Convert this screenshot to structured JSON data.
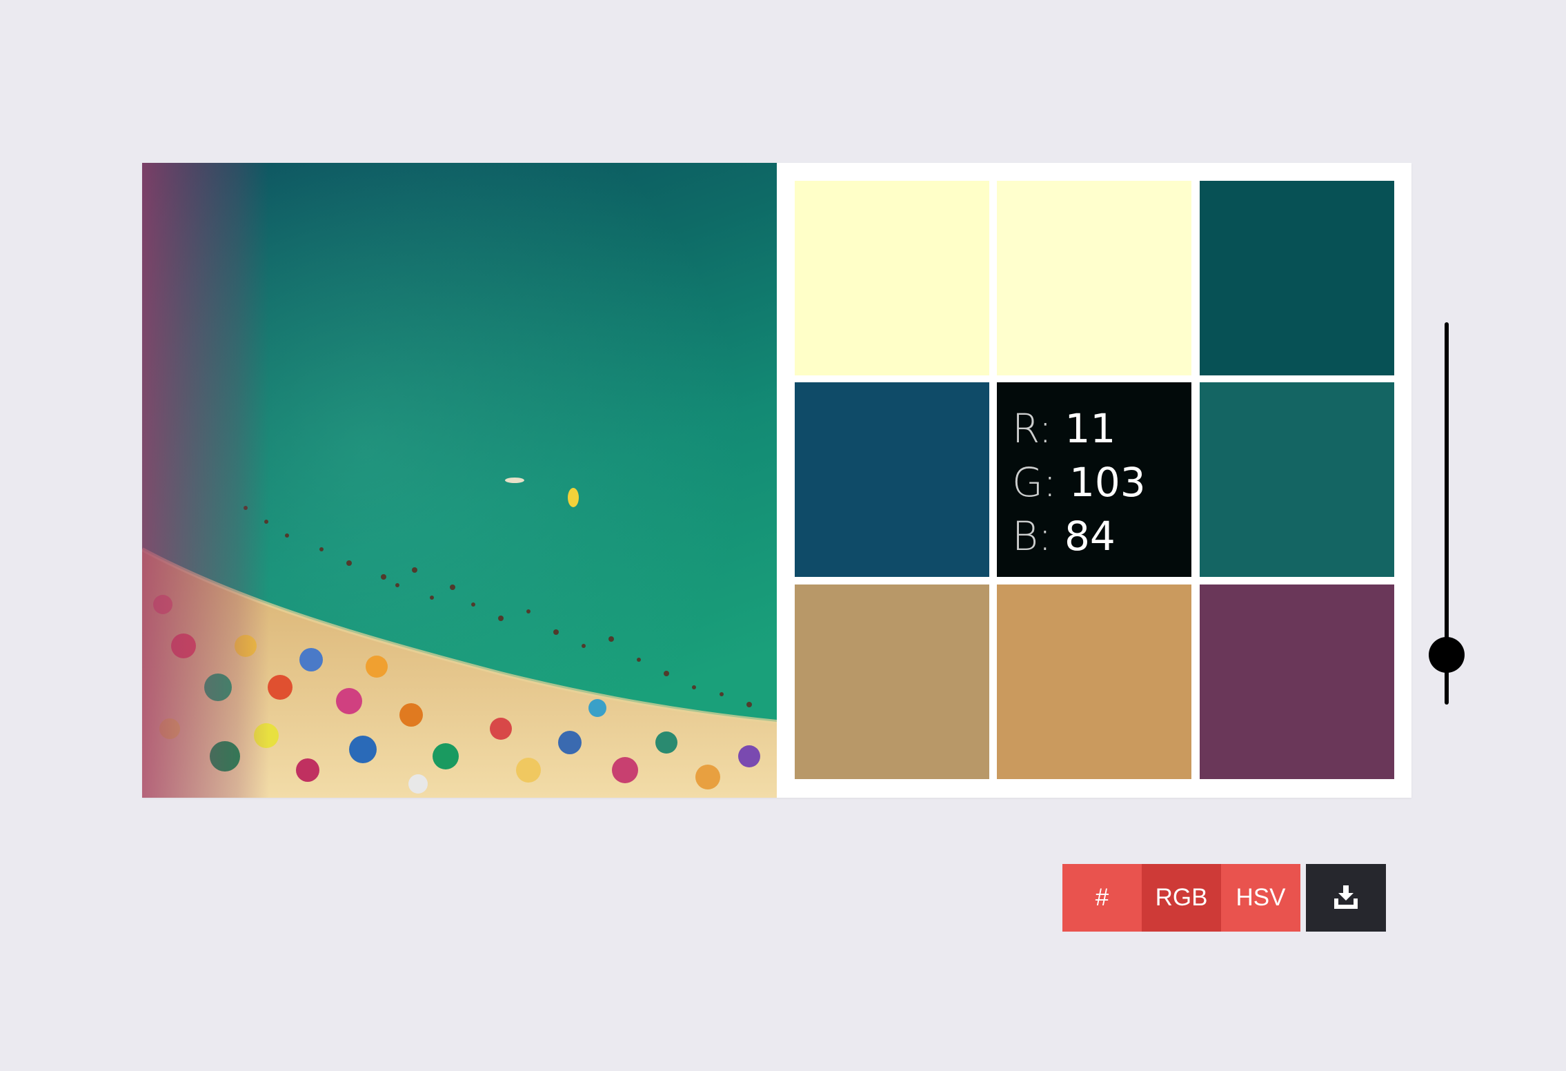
{
  "palette": {
    "swatches": [
      {
        "color": "#ffffc8"
      },
      {
        "color": "#ffffcd"
      },
      {
        "color": "#075155"
      },
      {
        "color": "#0f4b68"
      },
      {
        "color": "#020a0a"
      },
      {
        "color": "#146563"
      },
      {
        "color": "#b89868"
      },
      {
        "color": "#ca9a5e"
      },
      {
        "color": "#6a3759"
      }
    ],
    "active_readout": {
      "r_key": "R:",
      "r_value": "11",
      "g_key": "G:",
      "g_value": "103",
      "b_key": "B:",
      "b_value": "84"
    }
  },
  "slider": {
    "level": 0.87
  },
  "toolbar": {
    "hex_label": "#",
    "rgb_label": "RGB",
    "hsv_label": "HSV",
    "selected_format": "RGB",
    "download_icon": "download-tray-icon"
  },
  "photo": {
    "subject_icon": "beach-photo"
  }
}
